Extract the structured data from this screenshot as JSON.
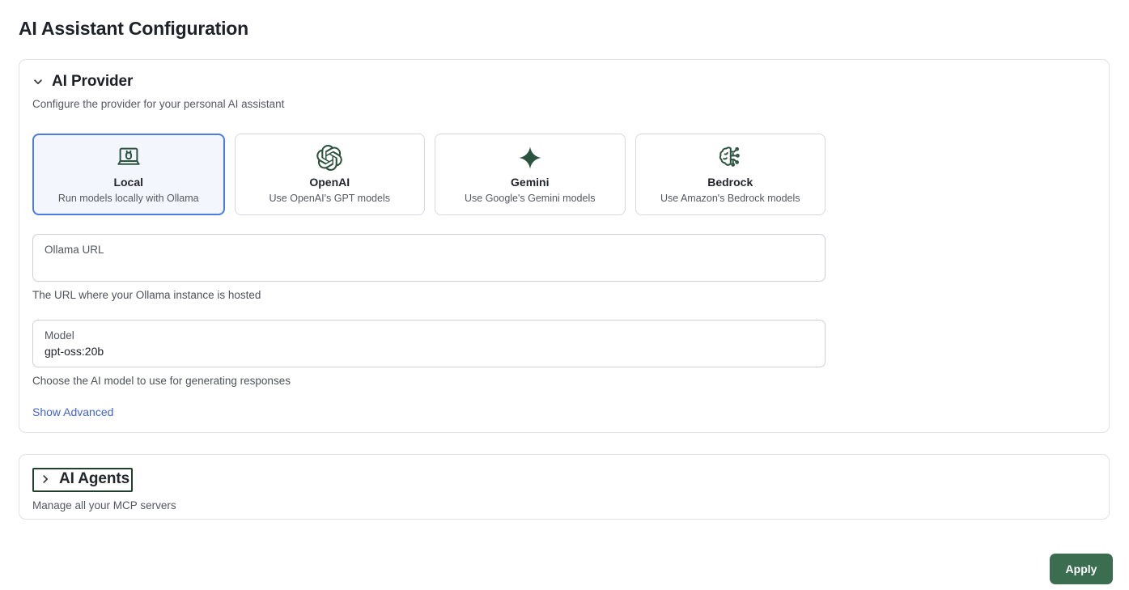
{
  "page": {
    "title": "AI Assistant Configuration"
  },
  "provider_section": {
    "title": "AI Provider",
    "subtitle": "Configure the provider for your personal AI assistant",
    "collapse_icon": "chevron-down",
    "providers": [
      {
        "name": "Local",
        "description": "Run models locally with Ollama",
        "icon": "laptop-llama-icon",
        "selected": true
      },
      {
        "name": "OpenAI",
        "description": "Use OpenAI's GPT models",
        "icon": "openai-icon",
        "selected": false
      },
      {
        "name": "Gemini",
        "description": "Use Google's Gemini models",
        "icon": "gemini-star-icon",
        "selected": false
      },
      {
        "name": "Bedrock",
        "description": "Use Amazon's Bedrock models",
        "icon": "brain-circuit-icon",
        "selected": false
      }
    ],
    "ollama_url_field": {
      "label": "Ollama URL",
      "value": "",
      "helper": "The URL where your Ollama instance is hosted"
    },
    "model_field": {
      "label": "Model",
      "value": "gpt-oss:20b",
      "helper": "Choose the AI model to use for generating responses"
    },
    "show_advanced_label": "Show Advanced"
  },
  "agents_section": {
    "title": "AI Agents",
    "subtitle": "Manage all your MCP servers",
    "collapse_icon": "chevron-right"
  },
  "footer": {
    "apply_label": "Apply"
  },
  "colors": {
    "selected_card_border": "#4b7ce0",
    "selected_card_background": "#f4f6fd",
    "icon_green": "#2c5340",
    "apply_button_green": "#3b6e50",
    "link_blue": "#4263d0",
    "focus_ring_green": "#20402e"
  }
}
